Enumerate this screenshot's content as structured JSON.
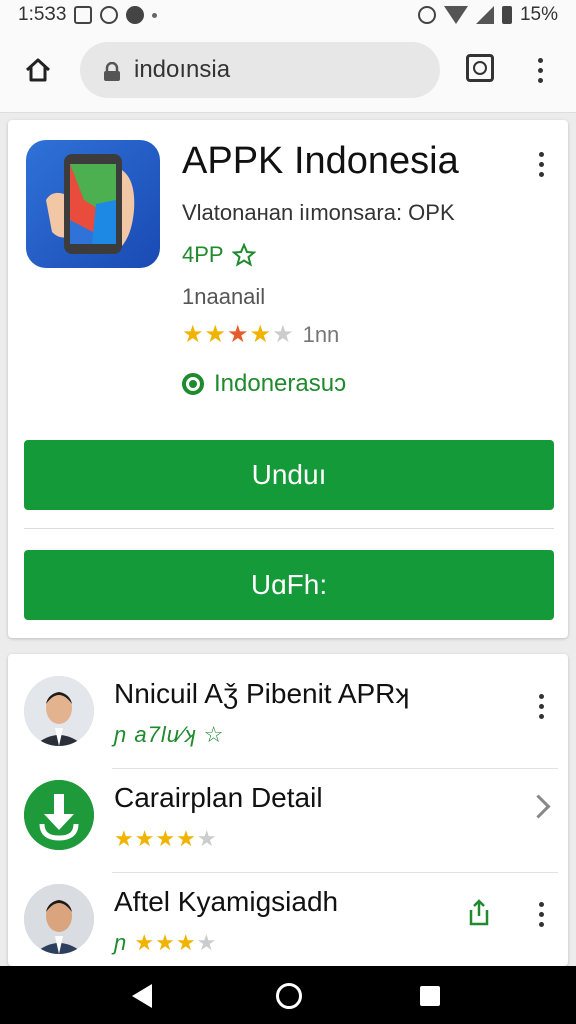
{
  "status_bar": {
    "time": "1:5З3",
    "battery": "15%"
  },
  "browser": {
    "url": "indoınsia"
  },
  "app": {
    "title": "APPK Indonesia",
    "subtitle": "Vlatonaнan iımonsara: OPK",
    "tag": "4PP",
    "meta": "1naanail",
    "rating_count": "1nn",
    "region": "Indonerasuɔ",
    "primary_button": "Unduı",
    "secondary_button": "UɑFh:"
  },
  "list": [
    {
      "title": "Nnicuil Aǯ Pibenit APRʞ",
      "rating_text": "ɲ a7lu⁄ʞ",
      "action": "more"
    },
    {
      "title": "Carairplan Detail",
      "action": "chevron"
    },
    {
      "title": "Aftel Kyamigsiadh",
      "rating_text": "ɲ",
      "action": "share+more"
    }
  ],
  "colors": {
    "accent_green": "#159a3a",
    "star_gold": "#f0b400",
    "text_green": "#1f8a2e"
  }
}
